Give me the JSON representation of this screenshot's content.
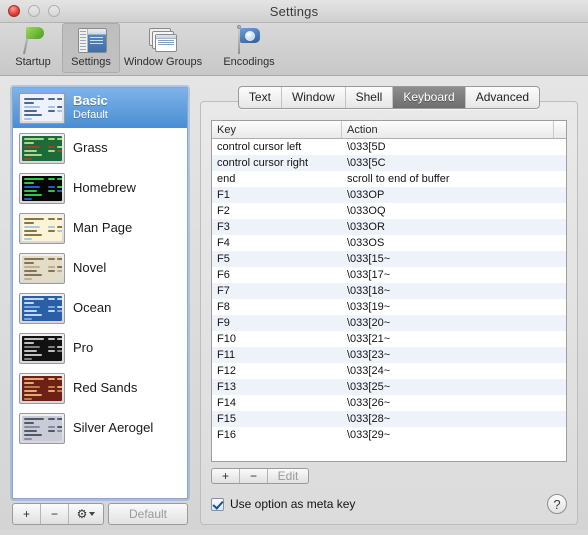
{
  "window": {
    "title": "Settings",
    "traffic": {
      "close": "close-button",
      "minimize": "minimize-button",
      "zoom": "zoom-button"
    }
  },
  "toolbar": {
    "items": [
      {
        "label": "Startup",
        "icon": "flag-icon",
        "selected": false
      },
      {
        "label": "Settings",
        "icon": "settings-window-icon",
        "selected": true
      },
      {
        "label": "Window Groups",
        "icon": "window-groups-icon",
        "selected": false
      },
      {
        "label": "Encodings",
        "icon": "encodings-flag-icon",
        "selected": false
      }
    ]
  },
  "sidebar": {
    "profiles": [
      {
        "name": "Basic",
        "subtitle": "Default",
        "selected": true,
        "bg": "#eef3fb",
        "fg": "#3a5c8c",
        "accent": "#9dbce0"
      },
      {
        "name": "Grass",
        "subtitle": "",
        "selected": false,
        "bg": "#1d6b3a",
        "fg": "#b9e08a",
        "accent": "#a8412c"
      },
      {
        "name": "Homebrew",
        "subtitle": "",
        "selected": false,
        "bg": "#050505",
        "fg": "#2fd94a",
        "accent": "#2b5fd0"
      },
      {
        "name": "Man Page",
        "subtitle": "",
        "selected": false,
        "bg": "#fbf4d6",
        "fg": "#7a6a3a",
        "accent": "#9fc4e4"
      },
      {
        "name": "Novel",
        "subtitle": "",
        "selected": false,
        "bg": "#e3dcc6",
        "fg": "#7a6a52",
        "accent": "#b8a98c"
      },
      {
        "name": "Ocean",
        "subtitle": "",
        "selected": false,
        "bg": "#2a5fa8",
        "fg": "#cfe2f6",
        "accent": "#7fb0e0"
      },
      {
        "name": "Pro",
        "subtitle": "",
        "selected": false,
        "bg": "#111111",
        "fg": "#cfcfcf",
        "accent": "#8a8a8a"
      },
      {
        "name": "Red Sands",
        "subtitle": "",
        "selected": false,
        "bg": "#6e2017",
        "fg": "#e8b97a",
        "accent": "#c08a4a"
      },
      {
        "name": "Silver Aerogel",
        "subtitle": "",
        "selected": false,
        "bg": "#c9ccd6",
        "fg": "#4a4e5c",
        "accent": "#7d84a0"
      }
    ],
    "toolbar": {
      "add_label": "+",
      "remove_label": "−",
      "gear_label": "⚙",
      "default_label": "Default"
    }
  },
  "pane": {
    "tabs": [
      {
        "label": "Text",
        "active": false
      },
      {
        "label": "Window",
        "active": false
      },
      {
        "label": "Shell",
        "active": false
      },
      {
        "label": "Keyboard",
        "active": true
      },
      {
        "label": "Advanced",
        "active": false
      }
    ],
    "table": {
      "headers": {
        "key": "Key",
        "action": "Action"
      },
      "rows": [
        {
          "key": "control cursor left",
          "action": "\\033[5D"
        },
        {
          "key": "control cursor right",
          "action": "\\033[5C"
        },
        {
          "key": "end",
          "action": "scroll to end of buffer"
        },
        {
          "key": "F1",
          "action": "\\033OP"
        },
        {
          "key": "F2",
          "action": "\\033OQ"
        },
        {
          "key": "F3",
          "action": "\\033OR"
        },
        {
          "key": "F4",
          "action": "\\033OS"
        },
        {
          "key": "F5",
          "action": "\\033[15~"
        },
        {
          "key": "F6",
          "action": "\\033[17~"
        },
        {
          "key": "F7",
          "action": "\\033[18~"
        },
        {
          "key": "F8",
          "action": "\\033[19~"
        },
        {
          "key": "F9",
          "action": "\\033[20~"
        },
        {
          "key": "F10",
          "action": "\\033[21~"
        },
        {
          "key": "F11",
          "action": "\\033[23~"
        },
        {
          "key": "F12",
          "action": "\\033[24~"
        },
        {
          "key": "F13",
          "action": "\\033[25~"
        },
        {
          "key": "F14",
          "action": "\\033[26~"
        },
        {
          "key": "F15",
          "action": "\\033[28~"
        },
        {
          "key": "F16",
          "action": "\\033[29~"
        }
      ]
    },
    "actions": {
      "add_label": "+",
      "remove_label": "−",
      "edit_label": "Edit"
    },
    "footer": {
      "meta_key_label": "Use option as meta key",
      "meta_key_checked": true,
      "help_label": "?"
    }
  }
}
